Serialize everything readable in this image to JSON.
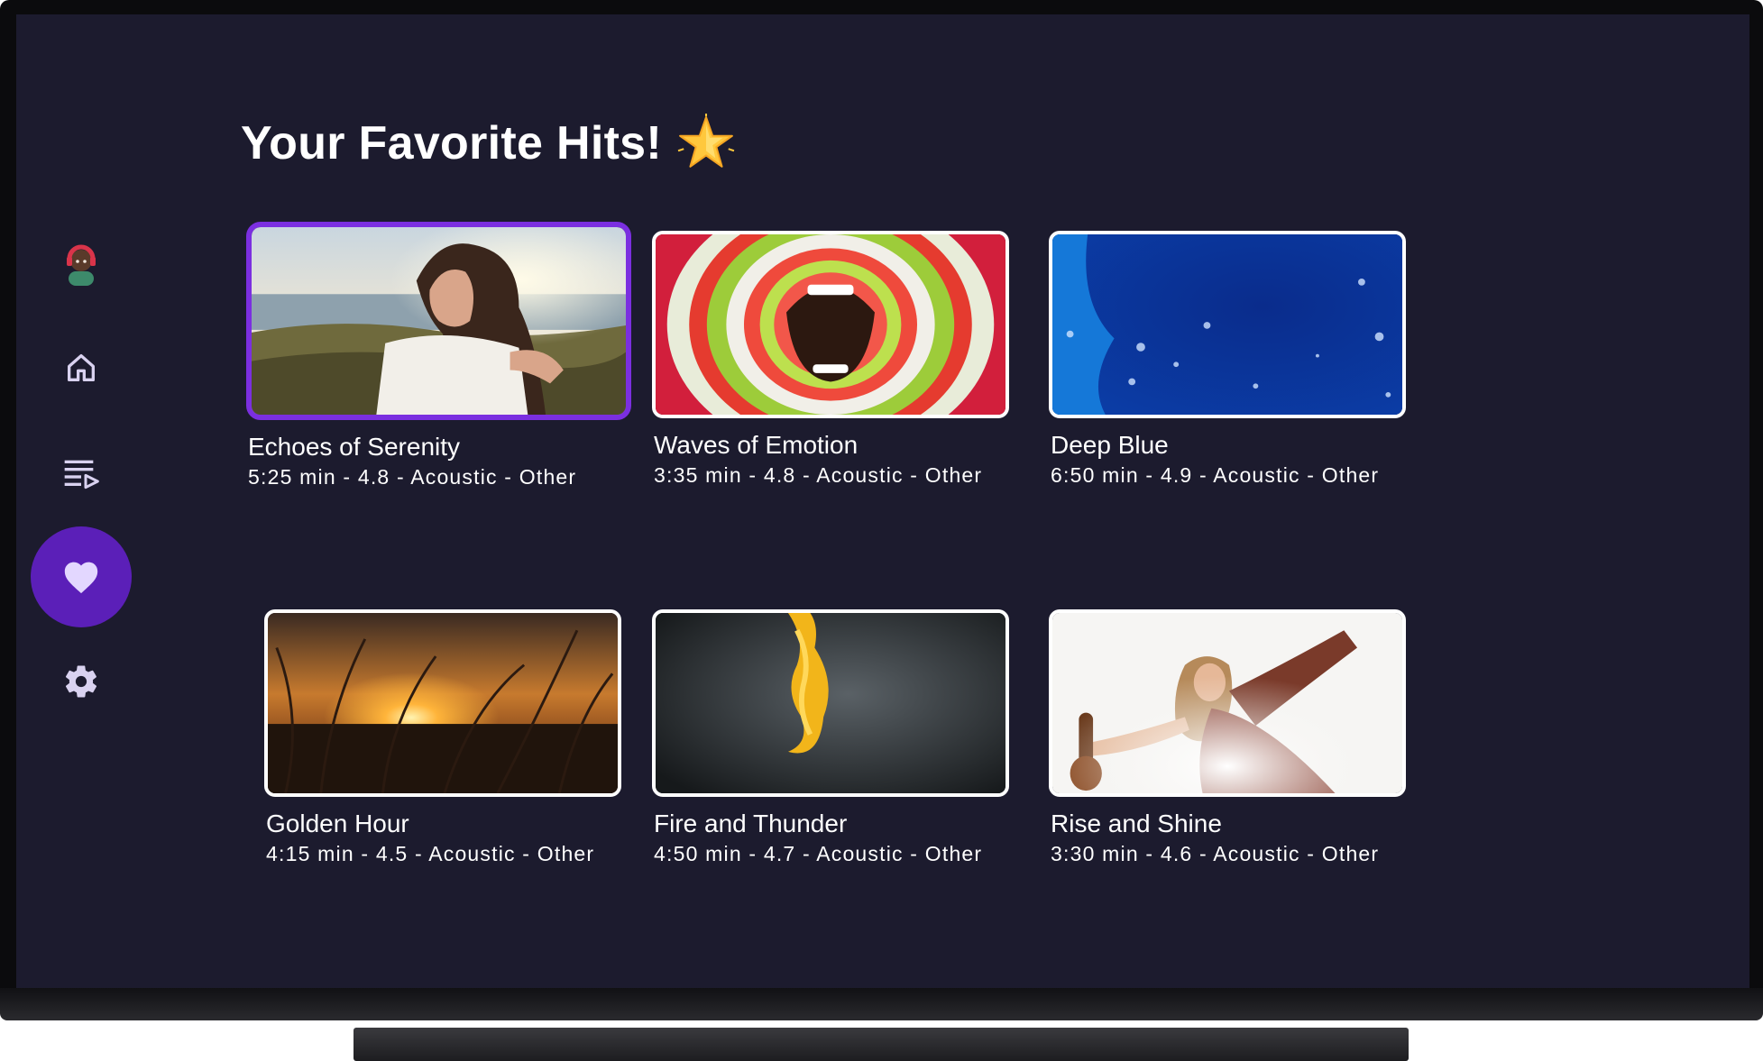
{
  "page": {
    "title": "Your Favorite Hits!",
    "title_icon": "sparkle-star-emoji"
  },
  "nav": {
    "items": [
      {
        "name": "profile-avatar",
        "icon": "avatar-icon",
        "active": false
      },
      {
        "name": "home",
        "icon": "home-icon",
        "active": false
      },
      {
        "name": "playlists",
        "icon": "playlist-icon",
        "active": false
      },
      {
        "name": "favorites",
        "icon": "heart-icon",
        "active": true
      },
      {
        "name": "settings",
        "icon": "gear-icon",
        "active": false
      }
    ],
    "active_color": "#5b1fb8",
    "icon_color": "#d9d2f0"
  },
  "colors": {
    "background": "#1c1b2e",
    "focus_border": "#7b2fe0",
    "text": "#ffffff"
  },
  "cards": [
    {
      "title": "Echoes of Serenity",
      "meta": "5:25 min  - 4.8 - Acoustic - Other",
      "focused": true
    },
    {
      "title": "Waves of Emotion",
      "meta": "3:35 min  - 4.8 - Acoustic - Other",
      "focused": false
    },
    {
      "title": "Deep Blue",
      "meta": "6:50 min  - 4.9 - Acoustic - Other",
      "focused": false
    },
    {
      "title": "Golden Hour",
      "meta": "4:15 min  - 4.5 - Acoustic - Other",
      "focused": false
    },
    {
      "title": "Fire and Thunder",
      "meta": "4:50 min  - 4.7 - Acoustic - Other",
      "focused": false
    },
    {
      "title": "Rise and Shine",
      "meta": "3:30 min  - 4.6 - Acoustic - Other",
      "focused": false
    }
  ]
}
